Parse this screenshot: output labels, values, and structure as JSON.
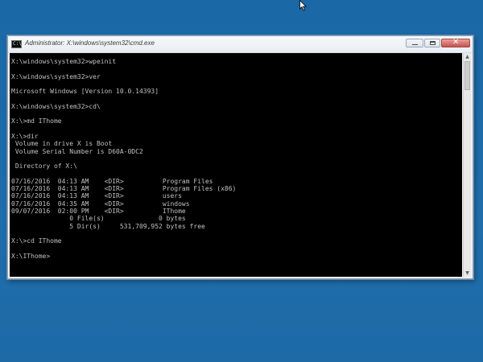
{
  "window": {
    "title": "Administrator: X:\\windows\\system32\\cmd.exe",
    "icon_label": "C:\\",
    "close_glyph": "✕"
  },
  "console": {
    "lines": [
      "X:\\windows\\system32>wpeinit",
      "",
      "X:\\windows\\system32>ver",
      "",
      "Microsoft Windows [Version 10.0.14393]",
      "",
      "X:\\windows\\system32>cd\\",
      "",
      "X:\\>md IThome",
      "",
      "X:\\>dir",
      " Volume in drive X is Boot",
      " Volume Serial Number is D60A-0DC2",
      "",
      " Directory of X:\\",
      "",
      "07/16/2016  04:13 AM    <DIR>          Program Files",
      "07/16/2016  04:13 AM    <DIR>          Program Files (x86)",
      "07/16/2016  04:13 AM    <DIR>          users",
      "07/16/2016  04:35 AM    <DIR>          windows",
      "09/07/2016  02:00 PM    <DIR>          IThome",
      "               0 File(s)              0 bytes",
      "               5 Dir(s)     531,709,952 bytes free",
      "",
      "X:\\>cd IThome",
      "",
      "X:\\IThome>"
    ]
  },
  "scrollbar": {
    "up_glyph": "▲",
    "down_glyph": "▼"
  },
  "colors": {
    "desktop_background": "#1c69a8",
    "console_background": "#000000",
    "console_text": "#c0c0c0",
    "close_button": "#c75050"
  },
  "icons": {
    "cursor": "mouse-cursor-icon",
    "app": "cmd-icon",
    "minimize": "minimize-icon",
    "maximize": "maximize-icon",
    "close": "close-icon"
  }
}
